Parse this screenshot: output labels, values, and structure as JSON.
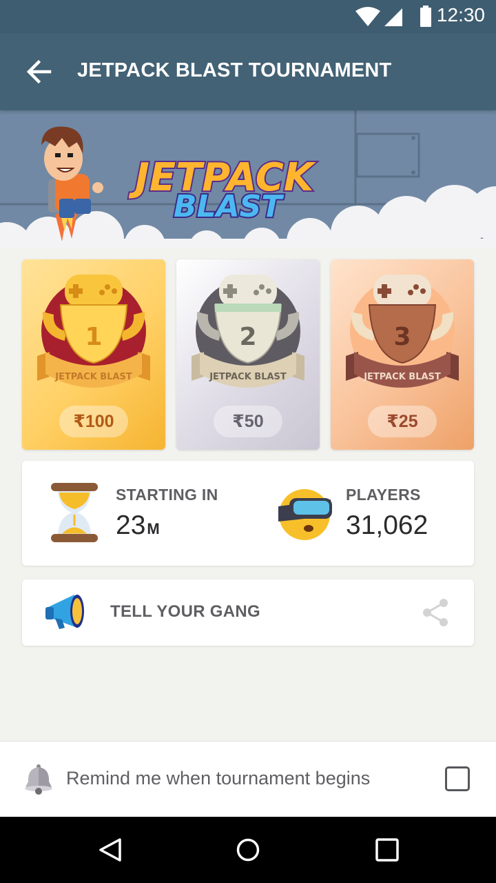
{
  "status_bar": {
    "time": "12:30"
  },
  "header": {
    "title": "JETPACK BLAST TOURNAMENT"
  },
  "banner": {
    "logo_line1": "JETPACK",
    "logo_line2": "BLAST"
  },
  "prizes": [
    {
      "rank": "1",
      "ribbon": "JETPACK BLAST",
      "amount": "₹100"
    },
    {
      "rank": "2",
      "ribbon": "JETPACK BLAST",
      "amount": "₹50"
    },
    {
      "rank": "3",
      "ribbon": "JETPACK BLAST",
      "amount": "₹25"
    }
  ],
  "info": {
    "starting_label": "STARTING IN",
    "starting_value": "23",
    "starting_unit": "M",
    "players_label": "PLAYERS",
    "players_value": "31,062"
  },
  "share": {
    "label": "TELL YOUR GANG"
  },
  "reminder": {
    "label": "Remind me when tournament begins",
    "checked": false
  },
  "icons": {
    "back": "arrow-back-icon",
    "wifi": "wifi-icon",
    "signal": "signal-icon",
    "battery": "battery-icon",
    "hourglass": "hourglass-icon",
    "players": "vr-face-icon",
    "megaphone": "megaphone-icon",
    "share": "share-icon",
    "bell": "bell-icon"
  }
}
